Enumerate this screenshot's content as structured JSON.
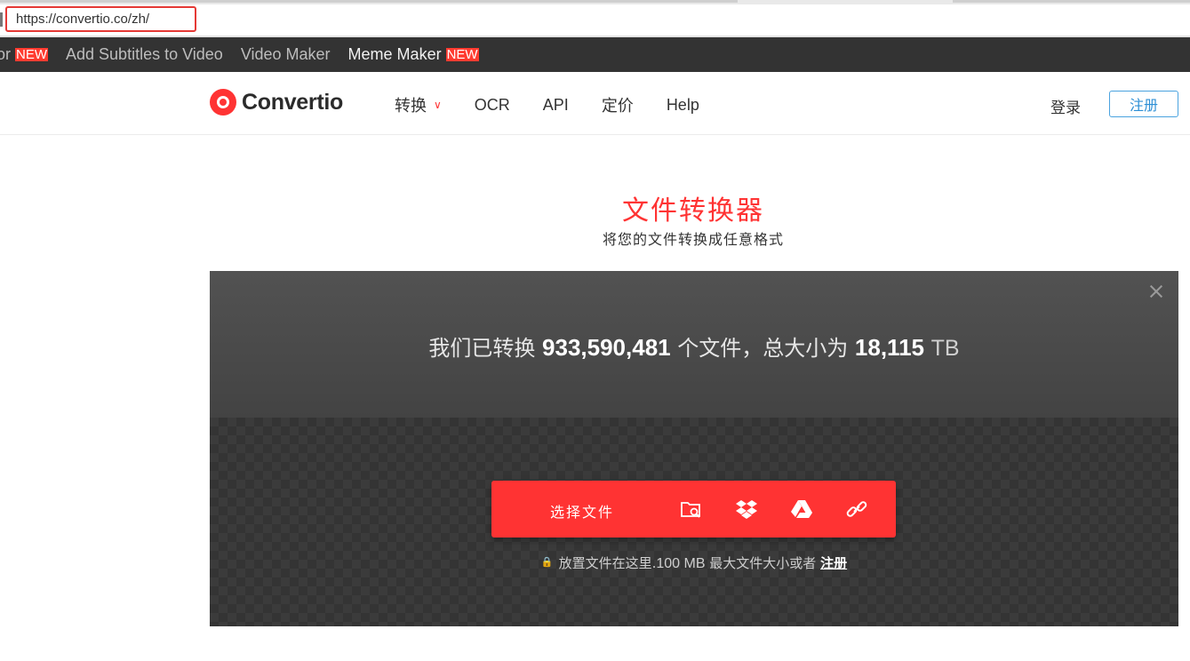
{
  "browser": {
    "url": "https://convertio.co/zh/"
  },
  "promo": {
    "items": [
      {
        "label": "or",
        "badge": "NEW"
      },
      {
        "label": "Add Subtitles to Video"
      },
      {
        "label": "Video Maker"
      },
      {
        "label": "Meme Maker",
        "badge": "NEW"
      }
    ]
  },
  "header": {
    "logo": "Convertio",
    "nav": [
      "转换",
      "OCR",
      "API",
      "定价",
      "Help"
    ],
    "login": "登录",
    "register": "注册"
  },
  "hero": {
    "title": "文件转换器",
    "subtitle": "将您的文件转换成任意格式"
  },
  "panel": {
    "stats_prefix": "我们已转换",
    "file_count": "933,590,481",
    "stats_mid": "个文件，总大小为",
    "total_size": "18,115",
    "size_unit": "TB",
    "choose_label": "选择文件",
    "hint_text": "放置文件在这里.",
    "hint_size": "100 MB",
    "hint_rest": "最大文件大小或者",
    "hint_link": "注册",
    "sources": [
      "folder-search-icon",
      "dropbox-icon",
      "google-drive-icon",
      "link-icon"
    ]
  },
  "colors": {
    "accent": "#ff3333",
    "dark_bar": "#333333",
    "panel": "#434343",
    "register_border": "#4aa3df"
  }
}
